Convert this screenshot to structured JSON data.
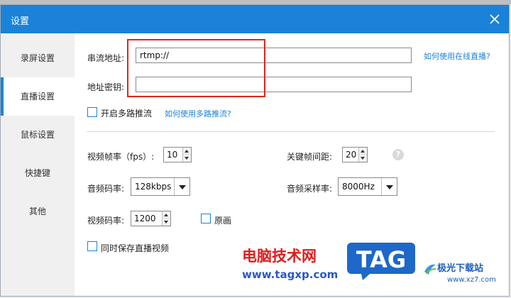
{
  "window": {
    "title": "设置"
  },
  "sidebar": {
    "items": [
      {
        "label": "录屏设置"
      },
      {
        "label": "直播设置"
      },
      {
        "label": "鼠标设置"
      },
      {
        "label": "快捷键"
      },
      {
        "label": "其他"
      }
    ],
    "active_index": 1
  },
  "stream": {
    "url_label": "串流地址:",
    "url_value": "rtmp://",
    "key_label": "地址密钥:",
    "key_value": "",
    "help_link": "如何使用在线直播?"
  },
  "multi_stream": {
    "checkbox_label": "开启多路推流",
    "checked": false,
    "help_link": "如何使用多路推流?"
  },
  "video": {
    "fps_label": "视频帧率（fps）:",
    "fps_value": "10",
    "keyframe_label": "关键帧间距:",
    "keyframe_value": "20",
    "help_icon": "?",
    "audio_bitrate_label": "音频码率:",
    "audio_bitrate_value": "128kbps",
    "audio_samplerate_label": "音频采样率:",
    "audio_samplerate_value": "8000Hz",
    "video_bitrate_label": "视频码率:",
    "video_bitrate_value": "1200",
    "original_label": "原画",
    "original_checked": false
  },
  "save_video": {
    "checkbox_label": "同时保存直播视频",
    "checked": false
  },
  "watermark": {
    "text": "电脑技术网",
    "url": "www.tagxp.com",
    "tag": "TAG",
    "site_name": "极光下载站",
    "site_url": "www.xz7.com"
  },
  "colors": {
    "accent": "#1a82d9",
    "highlight": "#e0251b",
    "watermark_red": "#e01d1d",
    "tag_blue": "#1d68c9"
  }
}
